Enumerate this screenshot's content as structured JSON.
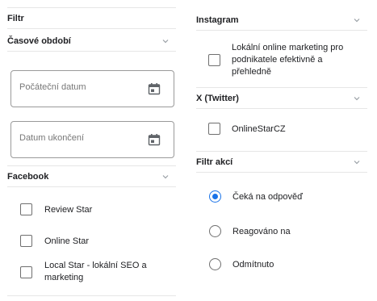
{
  "left": {
    "filter_title": "Filtr",
    "time_period": {
      "title": "Časové období"
    },
    "start_date": {
      "placeholder": "Počáteční datum",
      "icon": "calendar-icon"
    },
    "end_date": {
      "placeholder": "Datum ukončení",
      "icon": "calendar-icon"
    },
    "facebook": {
      "title": "Facebook",
      "items": [
        {
          "label": "Review Star",
          "checked": false
        },
        {
          "label": "Online Star",
          "checked": false
        },
        {
          "label_line1": "Local Star - lokální SEO a",
          "label_line2": "marketing",
          "checked": false
        }
      ]
    }
  },
  "right": {
    "instagram": {
      "title": "Instagram",
      "item": {
        "label_line1": "Lokální online marketing pro",
        "label_line2": "podnikatele efektivně a",
        "label_line3": "přehledně",
        "checked": false
      }
    },
    "twitter": {
      "title": "X (Twitter)",
      "item": {
        "label": "OnlineStarCZ",
        "checked": false
      }
    },
    "action_filter": {
      "title": "Filtr akcí",
      "options": [
        {
          "label": "Čeká na odpověď",
          "selected": true
        },
        {
          "label": "Reagováno na",
          "selected": false
        },
        {
          "label": "Odmítnuto",
          "selected": false
        }
      ]
    }
  },
  "colors": {
    "accent": "#1a73e8",
    "divider": "#e6e6e6",
    "text": "#202124",
    "border": "#9a9a9a"
  }
}
